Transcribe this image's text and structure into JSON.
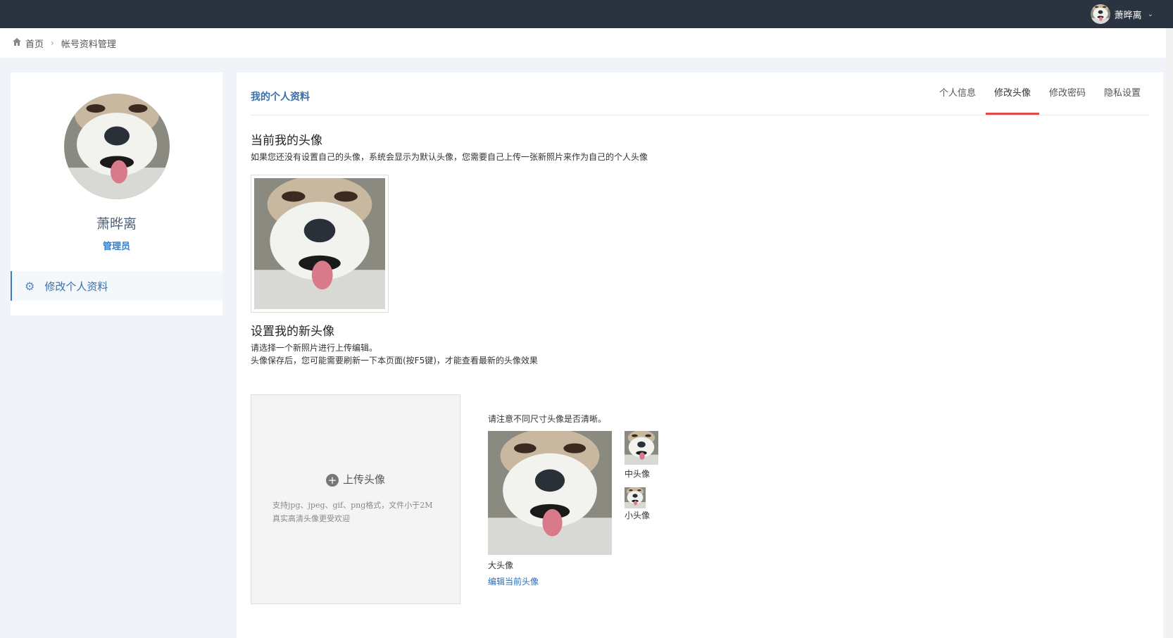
{
  "header": {
    "username": "萧晔离",
    "caret": "⌄",
    "avatar_icon": "dog-face-avatar"
  },
  "breadcrumb": {
    "home": "首页",
    "separator": "›",
    "current": "帐号资料管理"
  },
  "sidebar": {
    "name": "萧晔离",
    "role": "管理员",
    "menu_item": "修改个人资料"
  },
  "main": {
    "title": "我的个人资料",
    "tabs": [
      {
        "label": "个人信息"
      },
      {
        "label": "修改头像"
      },
      {
        "label": "修改密码"
      },
      {
        "label": "隐私设置"
      }
    ],
    "active_tab": "修改头像",
    "current_heading": "当前我的头像",
    "current_desc": "如果您还没有设置自己的头像，系统会显示为默认头像，您需要自己上传一张新照片来作为自己的个人头像",
    "new_heading": "设置我的新头像",
    "new_desc_1": "请选择一个新照片进行上传编辑。",
    "new_desc_2": "头像保存后，您可能需要刷新一下本页面(按F5键)，才能查看最新的头像效果",
    "upload_label": "上传头像",
    "upload_hint_1": "支持jpg、jpeg、gif、png格式，文件小于2M",
    "upload_hint_2": "真实高清头像更受欢迎",
    "preview_note": "请注意不同尺寸头像是否清晰。",
    "big_label": "大头像",
    "mid_label": "中头像",
    "small_label": "小头像",
    "edit_link": "编辑当前头像"
  },
  "colors": {
    "topbar": "#2a3441",
    "accent_blue": "#3a7dc4",
    "active_tab_underline": "#e04b4b",
    "page_bg": "#f0f3f8"
  }
}
